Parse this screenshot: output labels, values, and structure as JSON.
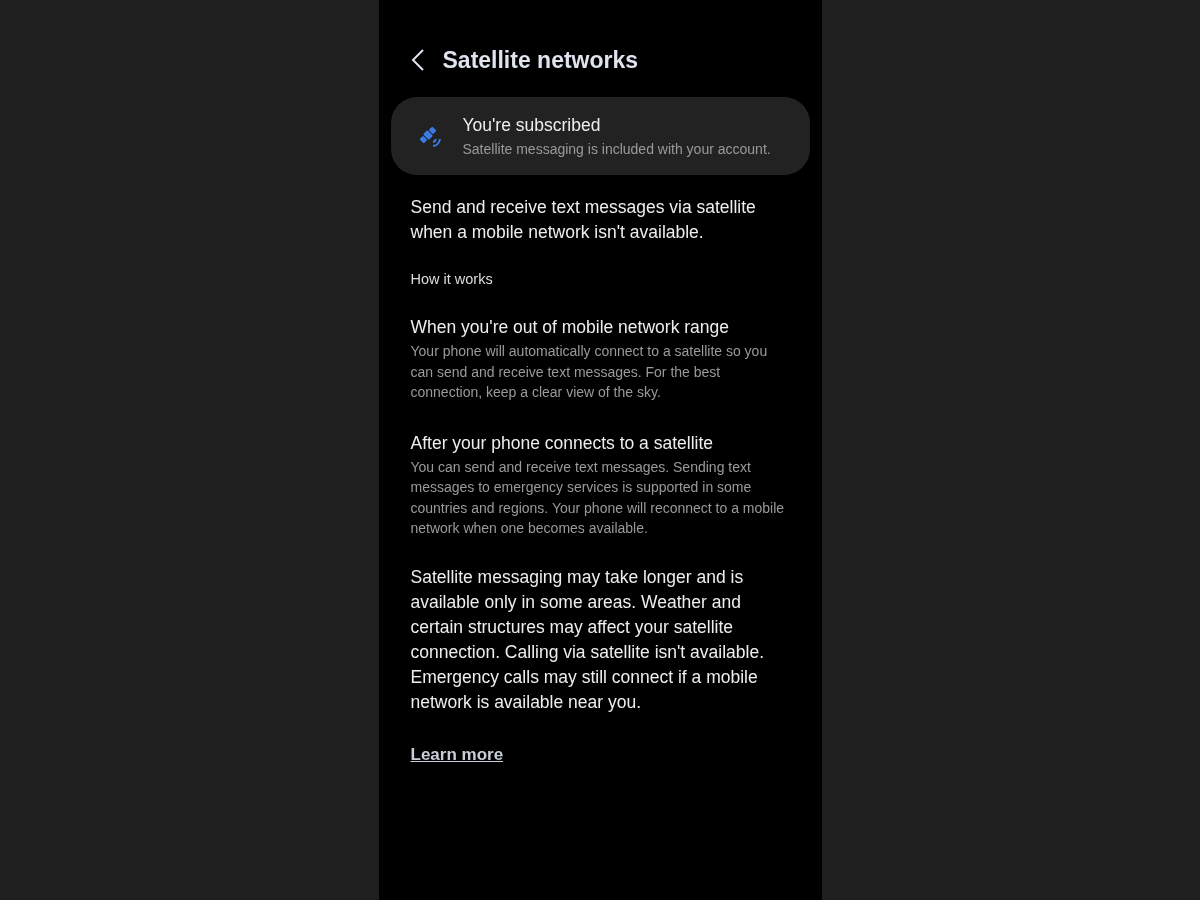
{
  "header": {
    "title": "Satellite networks"
  },
  "status_card": {
    "title": "You're subscribed",
    "subtitle": "Satellite messaging is included with your account."
  },
  "intro": "Send and receive text messages via satellite when a mobile network isn't available.",
  "section_label": "How it works",
  "steps": [
    {
      "title": "When you're out of mobile network range",
      "body": "Your phone will automatically connect to a satellite so you can send and receive text messages. For the best connection, keep a clear view of the sky."
    },
    {
      "title": "After your phone connects to a satellite",
      "body": "You can send and receive text messages. Sending text messages to emergency services is supported in some countries and regions. Your phone will reconnect to a mobile network when one becomes available."
    }
  ],
  "note": "Satellite messaging may take longer and is available only in some areas. Weather and certain structures may affect your satellite connection. Calling via satellite isn't available. Emergency calls may still connect if a mobile network is available near you.",
  "link": "Learn more"
}
